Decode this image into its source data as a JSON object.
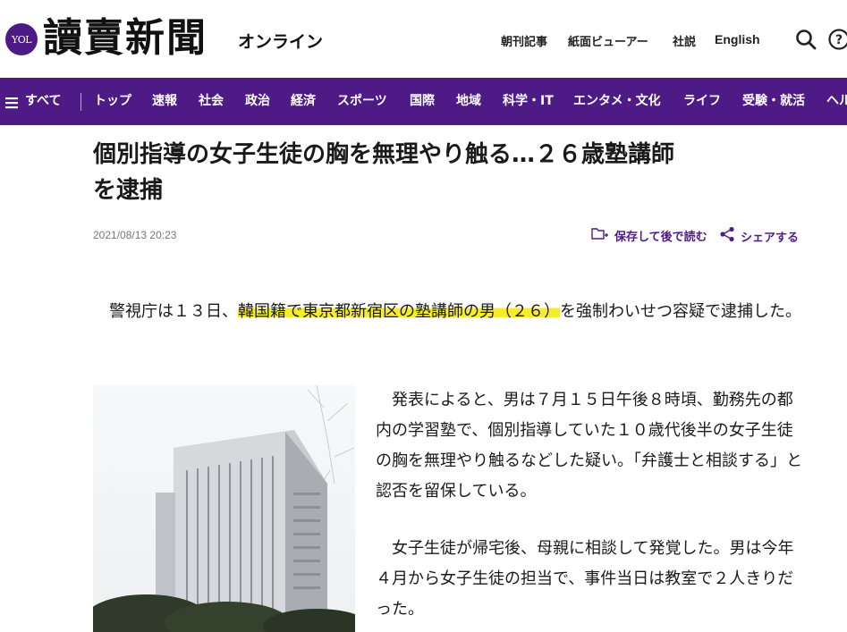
{
  "header": {
    "badge": "YOL",
    "logo_text": "讀賣新聞",
    "logo_sub": "オンライン",
    "links": [
      "朝刊記事",
      "紙面ビューアー",
      "社説",
      "English"
    ],
    "icons": [
      "search-icon",
      "help-icon"
    ]
  },
  "nav": {
    "all_label": "すべて",
    "items": [
      "トップ",
      "速報",
      "社会",
      "政治",
      "経済",
      "スポーツ",
      "国際",
      "地域",
      "科学・IT",
      "エンタメ・文化",
      "ライフ",
      "受験・就活",
      "ヘル"
    ]
  },
  "article": {
    "headline_line1": "個別指導の女子生徒の胸を無理やり触る…２６歳塾講師",
    "headline_line2": "を逮捕",
    "date": "2021/08/13 20:23",
    "save_label": "保存して後で読む",
    "share_label": "シェアする",
    "p1_before": "　警視庁は１３日、",
    "p1_highlight": "韓国籍で東京都新宿区の塾講師の男（２６）",
    "p1_after": "を強制わいせつ容疑で逮捕した。",
    "p2": "　発表によると、男は７月１５日午後８時頃、勤務先の都内の学習塾で、個別指導していた１０歳代後半の女子生徒の胸を無理やり触るなどした疑い。「弁護士と相談する」と認否を留保している。",
    "p3": "　女子生徒が帰宅後、母親に相談して発覚した。男は今年４月から女子生徒の担当で、事件当日は教室で２人きりだった。"
  },
  "colors": {
    "brand": "#4e1a86",
    "highlight": "#f7ec2b"
  }
}
